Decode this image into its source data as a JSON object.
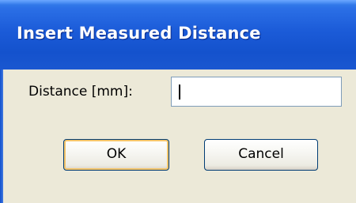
{
  "dialog": {
    "title": "Insert Measured Distance"
  },
  "form": {
    "distance_label": "Distance [mm]:",
    "distance_value": ""
  },
  "buttons": {
    "ok_label": "OK",
    "cancel_label": "Cancel"
  }
}
